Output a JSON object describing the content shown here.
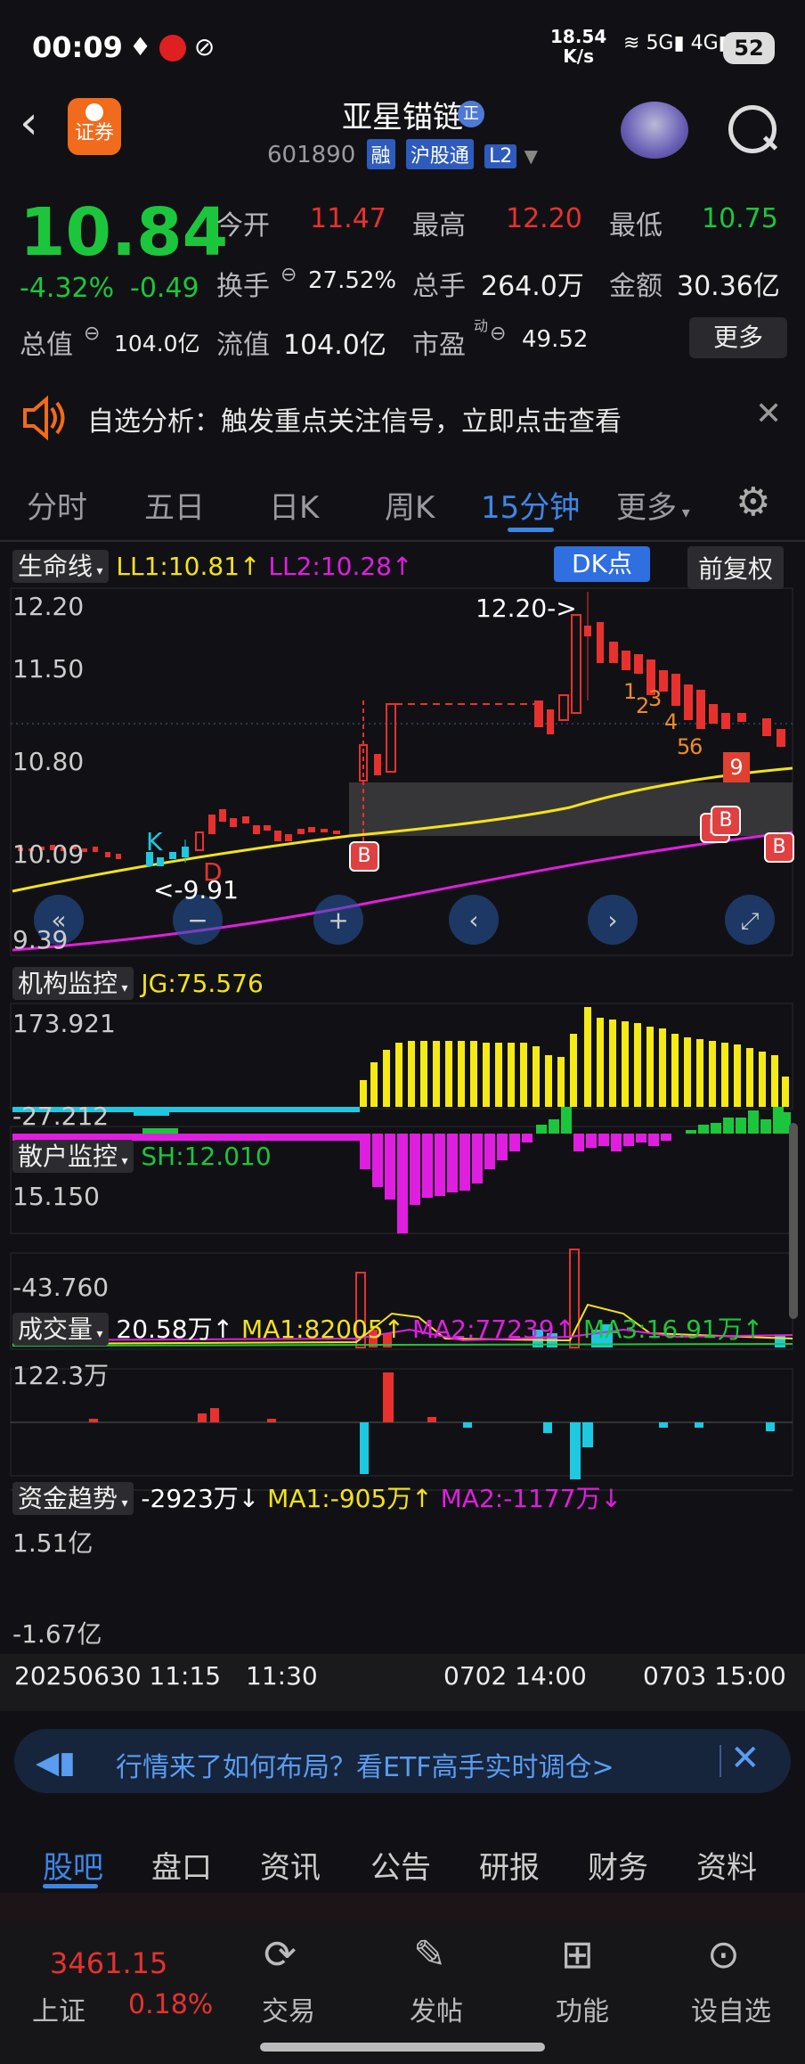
{
  "status_bar": {
    "time": "00:09",
    "speed": "18.54",
    "speed_unit": "K/s",
    "battery": "52",
    "signal1": "5G",
    "signal2": "4G"
  },
  "header": {
    "title": "亚星锚链",
    "zheng_badge": "正",
    "code": "601890",
    "tag1": "融",
    "tag2": "沪股通",
    "tag3": "L2",
    "logo_label": "证券"
  },
  "quote": {
    "price": "10.84",
    "pct": "-4.32%",
    "chg": "-0.49",
    "open_label": "今开",
    "open": "11.47",
    "high_label": "最高",
    "high": "12.20",
    "low_label": "最低",
    "low": "10.75",
    "turnover_label": "换手",
    "turnover": "27.52%",
    "vol_label": "总手",
    "vol": "264.0万",
    "amount_label": "金额",
    "amount": "30.36亿",
    "mktcap_label": "总值",
    "mktcap": "104.0亿",
    "float_label": "流值",
    "float": "104.0亿",
    "pe_label": "市盈",
    "pe_sup": "动",
    "pe": "49.52",
    "more": "更多"
  },
  "alert": {
    "text": "自选分析：触发重点关注信号，立即点击查看"
  },
  "period_tabs": [
    "分时",
    "五日",
    "日K",
    "周K",
    "15分钟",
    "更多"
  ],
  "active_tab": "15分钟",
  "main_chart": {
    "indicator": "生命线",
    "ll1": "LL1:10.81",
    "ll2": "LL2:10.28",
    "dk_button": "DK点",
    "fq_button": "前复权",
    "y_ticks": [
      "12.20",
      "11.50",
      "10.80",
      "10.09",
      "9.39"
    ],
    "high_note": "12.20->",
    "low_note": "<-9.91",
    "k_mark": "K",
    "d_mark": "D",
    "b_marks": [
      "B",
      "B",
      "B",
      "B"
    ],
    "seq_marks": [
      "1",
      "2",
      "3",
      "4",
      "5",
      "6",
      "9"
    ]
  },
  "jg": {
    "label": "机构监控",
    "value": "JG:75.576",
    "max": "173.921",
    "min": "-27.212"
  },
  "sh": {
    "label": "散户监控",
    "value": "SH:12.010",
    "max": "15.150",
    "min": "-43.760"
  },
  "volume": {
    "label": "成交量",
    "value": "20.58万",
    "ma1": "MA1:82005",
    "ma2": "MA2:77239",
    "ma3": "MA3:16.91万",
    "max": "122.3万"
  },
  "fund": {
    "label": "资金趋势",
    "value": "-2923万",
    "ma1": "MA1:-905万",
    "ma2": "MA2:-1177万",
    "max": "1.51亿",
    "min": "-1.67亿"
  },
  "x_axis": {
    "start": "20250630 11:15",
    "mid1": "11:30",
    "mid2": "0702 14:00",
    "end": "0703 15:00"
  },
  "ad": {
    "text": "行情来了如何布局？看ETF高手实时调仓>"
  },
  "bottom_tabs": [
    "股吧",
    "盘口",
    "资讯",
    "公告",
    "研报",
    "财务",
    "资料"
  ],
  "bottom_nav": {
    "index_value": "3461.15",
    "index_name": "上证",
    "index_pct": "0.18%",
    "trade": "交易",
    "post": "发帖",
    "func": "功能",
    "settings": "设自选"
  },
  "colors": {
    "up": "#e8312e",
    "down": "#1cc63c",
    "accent": "#3d86e8",
    "ll1": "#f2e21b",
    "ll2": "#e01ee0"
  }
}
